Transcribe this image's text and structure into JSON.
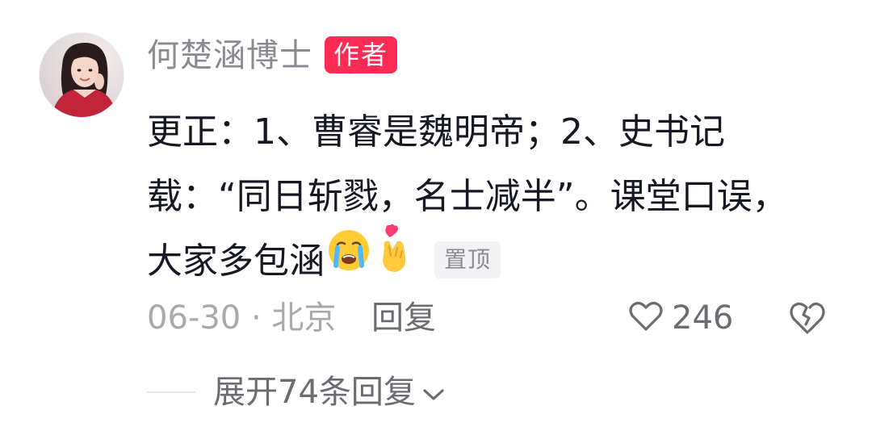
{
  "comment": {
    "author": {
      "name": "何楚涵博士",
      "badge": "作者"
    },
    "text_lines": [
      "更正：1、曹睿是魏明帝；2、史书记",
      "载：“同日斩戮，名士减半”。课堂口误，",
      "大家多包涵"
    ],
    "emojis": [
      "loudly-crying-face",
      "finger-heart-emoji"
    ],
    "pin_label": "置顶",
    "date": "06-30",
    "separator": "·",
    "location": "北京",
    "reply_label": "回复",
    "like_count": "246",
    "expand_label": "展开74条回复"
  },
  "colors": {
    "badge_red": "#fe2c55",
    "text_primary": "#161823",
    "text_secondary": "#8a8b91",
    "meta_gray": "#a8a8ad"
  }
}
